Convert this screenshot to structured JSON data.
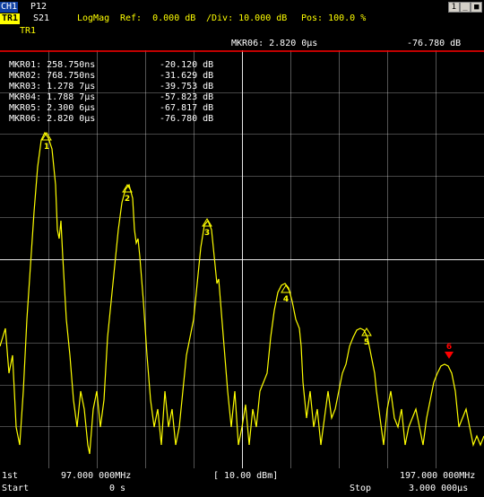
{
  "header": {
    "channel": "CH1",
    "param": "P12",
    "trace": "TR1",
    "sparam": "S21",
    "trace_label": "TR1",
    "format": "LogMag",
    "ref": "Ref:  0.000 dB",
    "div": "/Div: 10.000 dB",
    "pos": "Pos: 100.0 %",
    "window_number": "1"
  },
  "active_marker": {
    "label": "MKR06: 2.820 0μs",
    "value": "-76.780 dB"
  },
  "marker_table": [
    {
      "name": "MKR01: 258.750ns",
      "value": "-20.120 dB"
    },
    {
      "name": "MKR02: 768.750ns",
      "value": "-31.629 dB"
    },
    {
      "name": "MKR03: 1.278 7μs",
      "value": "-39.753 dB"
    },
    {
      "name": "MKR04: 1.788 7μs",
      "value": "-57.823 dB"
    },
    {
      "name": "MKR05: 2.300 6μs",
      "value": "-67.817 dB"
    },
    {
      "name": "MKR06: 2.820 0μs",
      "value": "-76.780 dB"
    }
  ],
  "footer": {
    "row1_left": "1st",
    "row1_mid_left": "97.000 000MHz",
    "row1_center": "[ 10.00 dBm]",
    "row1_right": "197.000 000MHz",
    "row2_left": "Start",
    "row2_mid_left": "0 s",
    "row2_right_label": "Stop",
    "row2_right": "3.000 000μs"
  },
  "marker_numbers": [
    "1",
    "2",
    "3",
    "4",
    "5",
    "6"
  ],
  "colors": {
    "trace": "#ffff00",
    "grid": "#ffffff",
    "ref_line": "#ff0000",
    "active_marker": "#ff0000",
    "text": "#ffff00",
    "header_text": "#ffffff"
  }
}
